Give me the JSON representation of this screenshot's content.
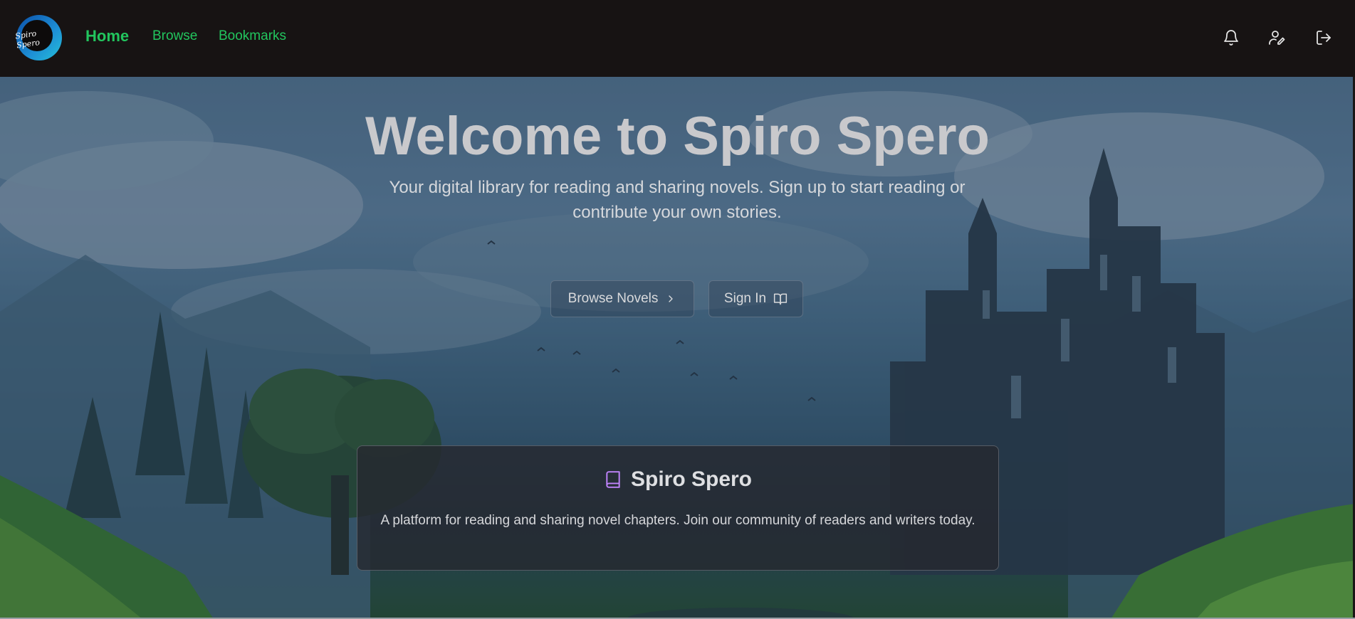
{
  "app": {
    "logo_text": "Spiro Spero"
  },
  "nav": {
    "home": "Home",
    "browse": "Browse",
    "bookmarks": "Bookmarks"
  },
  "toolbar_icons": [
    "bell-icon",
    "user-edit-icon",
    "logout-icon"
  ],
  "hero": {
    "title": "Welcome to Spiro Spero",
    "subtitle": "Your digital library for reading and sharing novels. Sign up to start reading or contribute your own stories.",
    "browse_button": "Browse Novels",
    "signin_button": "Sign In"
  },
  "card": {
    "title": "Spiro Spero",
    "description": "A platform for reading and sharing novel chapters. Join our community of readers and writers today."
  },
  "colors": {
    "accent": "#22c55e",
    "topbar": "#171313",
    "card_icon": "#c084fc"
  }
}
